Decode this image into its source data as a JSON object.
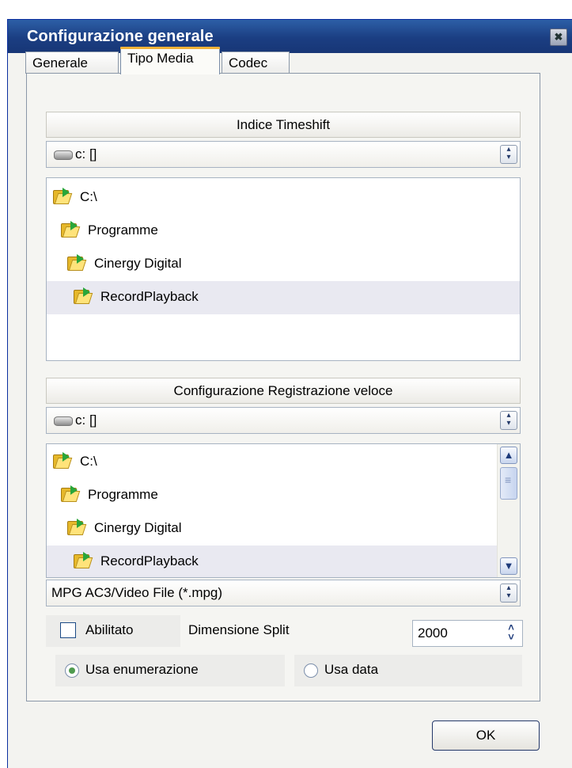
{
  "window": {
    "title": "Configurazione generale",
    "close_glyph": "✖"
  },
  "tabs": [
    {
      "label": "Generale",
      "active": false
    },
    {
      "label": "Tipo Media",
      "active": true
    },
    {
      "label": "Codec",
      "active": false
    }
  ],
  "timeshift": {
    "header": "Indice Timeshift",
    "drive": "c: []",
    "folders": [
      "C:\\",
      "Programme",
      "Cinergy Digital",
      "RecordPlayback"
    ],
    "selected_index": 3
  },
  "quickrec": {
    "header": "Configurazione Registrazione veloce",
    "drive": "c: []",
    "folders": [
      "C:\\",
      "Programme",
      "Cinergy Digital",
      "RecordPlayback"
    ],
    "selected_index": 3,
    "file_type": "MPG AC3/Video File (*.mpg)",
    "enabled_label": "Abilitato",
    "enabled": false,
    "split_label": "Dimensione Split",
    "split_value": "2000",
    "radio_enum_label": "Usa enumerazione",
    "radio_date_label": "Usa data",
    "radio_selected": "enumerazione"
  },
  "buttons": {
    "ok": "OK"
  },
  "icons": [
    "drive-icon",
    "folder-icon",
    "close-icon",
    "scroll-up-icon",
    "scroll-down-icon",
    "spin-icon"
  ],
  "colors": {
    "titlebar": "#1b3e82",
    "tab_accent": "#f3b238",
    "selection": "#e9e9f1",
    "panel": "#f5f5f2"
  }
}
